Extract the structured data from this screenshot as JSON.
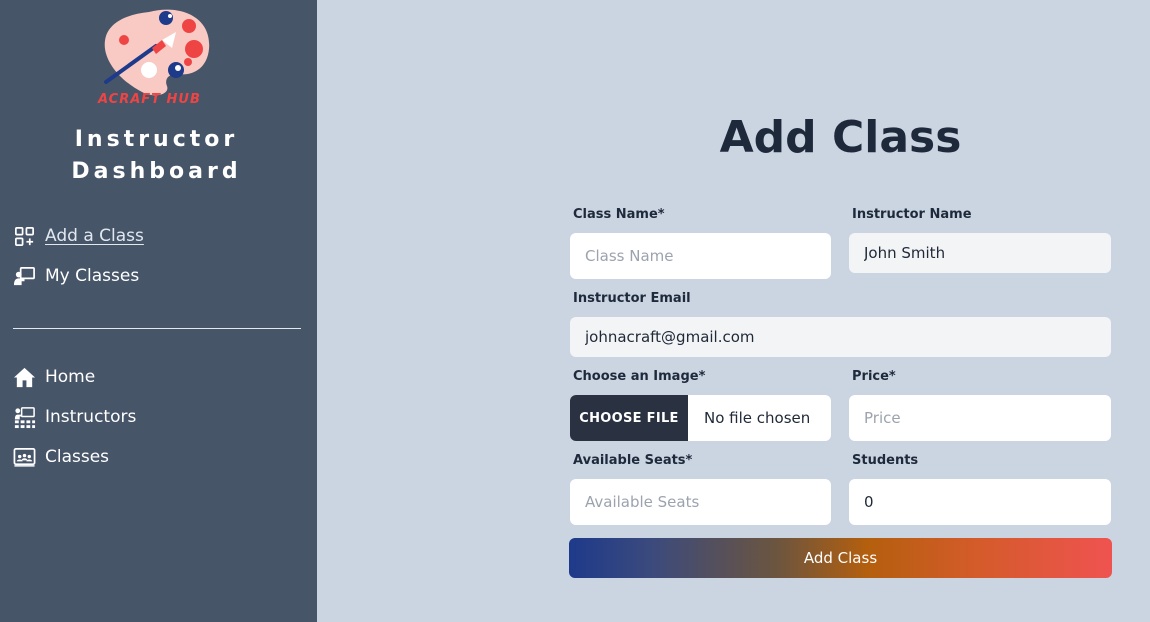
{
  "sidebar": {
    "logo_text": "ACRAFT HUB",
    "title_line1": "Instructor",
    "title_line2": "Dashboard",
    "instructor_nav": [
      {
        "label": "Add a Class",
        "icon": "add-grid-icon"
      },
      {
        "label": "My Classes",
        "icon": "teacher-board-icon"
      }
    ],
    "main_nav": [
      {
        "label": "Home",
        "icon": "home-icon"
      },
      {
        "label": "Instructors",
        "icon": "classroom-icon"
      },
      {
        "label": "Classes",
        "icon": "class-board-icon"
      }
    ]
  },
  "form": {
    "title": "Add Class",
    "class_name": {
      "label": "Class Name*",
      "placeholder": "Class Name",
      "value": ""
    },
    "instructor_name": {
      "label": "Instructor Name",
      "value": "John Smith"
    },
    "instructor_email": {
      "label": "Instructor Email",
      "value": "johnacraft@gmail.com"
    },
    "image": {
      "label": "Choose an Image*",
      "button": "CHOOSE FILE",
      "status": "No file chosen"
    },
    "price": {
      "label": "Price*",
      "placeholder": "Price",
      "value": ""
    },
    "available_seats": {
      "label": "Available Seats*",
      "placeholder": "Available Seats",
      "value": ""
    },
    "students": {
      "label": "Students",
      "value": "0"
    },
    "submit_label": "Add Class"
  },
  "colors": {
    "sidebar_bg": "#475569",
    "main_bg": "#cbd5e1",
    "file_button_bg": "#2a3140",
    "gradient_start": "#1e3a8a",
    "gradient_mid": "#b45f0e",
    "gradient_end": "#ef5350"
  }
}
